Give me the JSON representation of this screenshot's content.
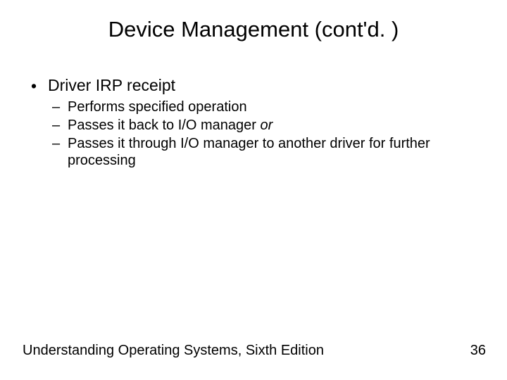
{
  "title": "Device Management (cont'd. )",
  "bullets": {
    "lvl1": "Driver IRP receipt",
    "sub1": "Performs specified operation",
    "sub2_a": "Passes it back to I/O manager ",
    "sub2_b": "or",
    "sub3": "Passes it through I/O manager to another driver for further processing"
  },
  "footer": {
    "left": "Understanding Operating Systems, Sixth Edition",
    "page": "36"
  }
}
